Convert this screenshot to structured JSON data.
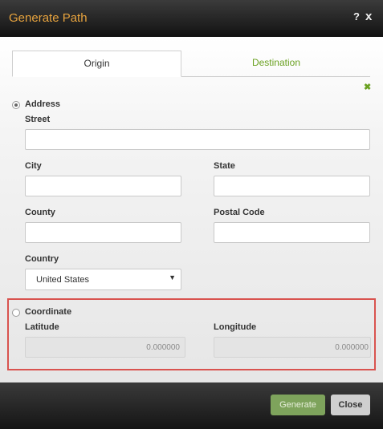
{
  "dialog": {
    "title": "Generate Path",
    "help_glyph": "?",
    "close_glyph": "x"
  },
  "tabs": [
    {
      "label": "Origin",
      "active": true
    },
    {
      "label": "Destination",
      "active": false
    }
  ],
  "remove_glyph": "✖",
  "address": {
    "option_label": "Address",
    "selected": true,
    "street_label": "Street",
    "street_value": "",
    "city_label": "City",
    "city_value": "",
    "state_label": "State",
    "state_value": "",
    "county_label": "County",
    "county_value": "",
    "postal_label": "Postal Code",
    "postal_value": "",
    "country_label": "Country",
    "country_value": "United States"
  },
  "coordinate": {
    "option_label": "Coordinate",
    "selected": false,
    "latitude_label": "Latitude",
    "latitude_value": "0.000000",
    "longitude_label": "Longitude",
    "longitude_value": "0.000000"
  },
  "footer": {
    "generate_label": "Generate",
    "close_label": "Close"
  },
  "colors": {
    "title": "#e7a33e",
    "accent_green": "#6aa121",
    "highlight_border": "#d9534f"
  }
}
